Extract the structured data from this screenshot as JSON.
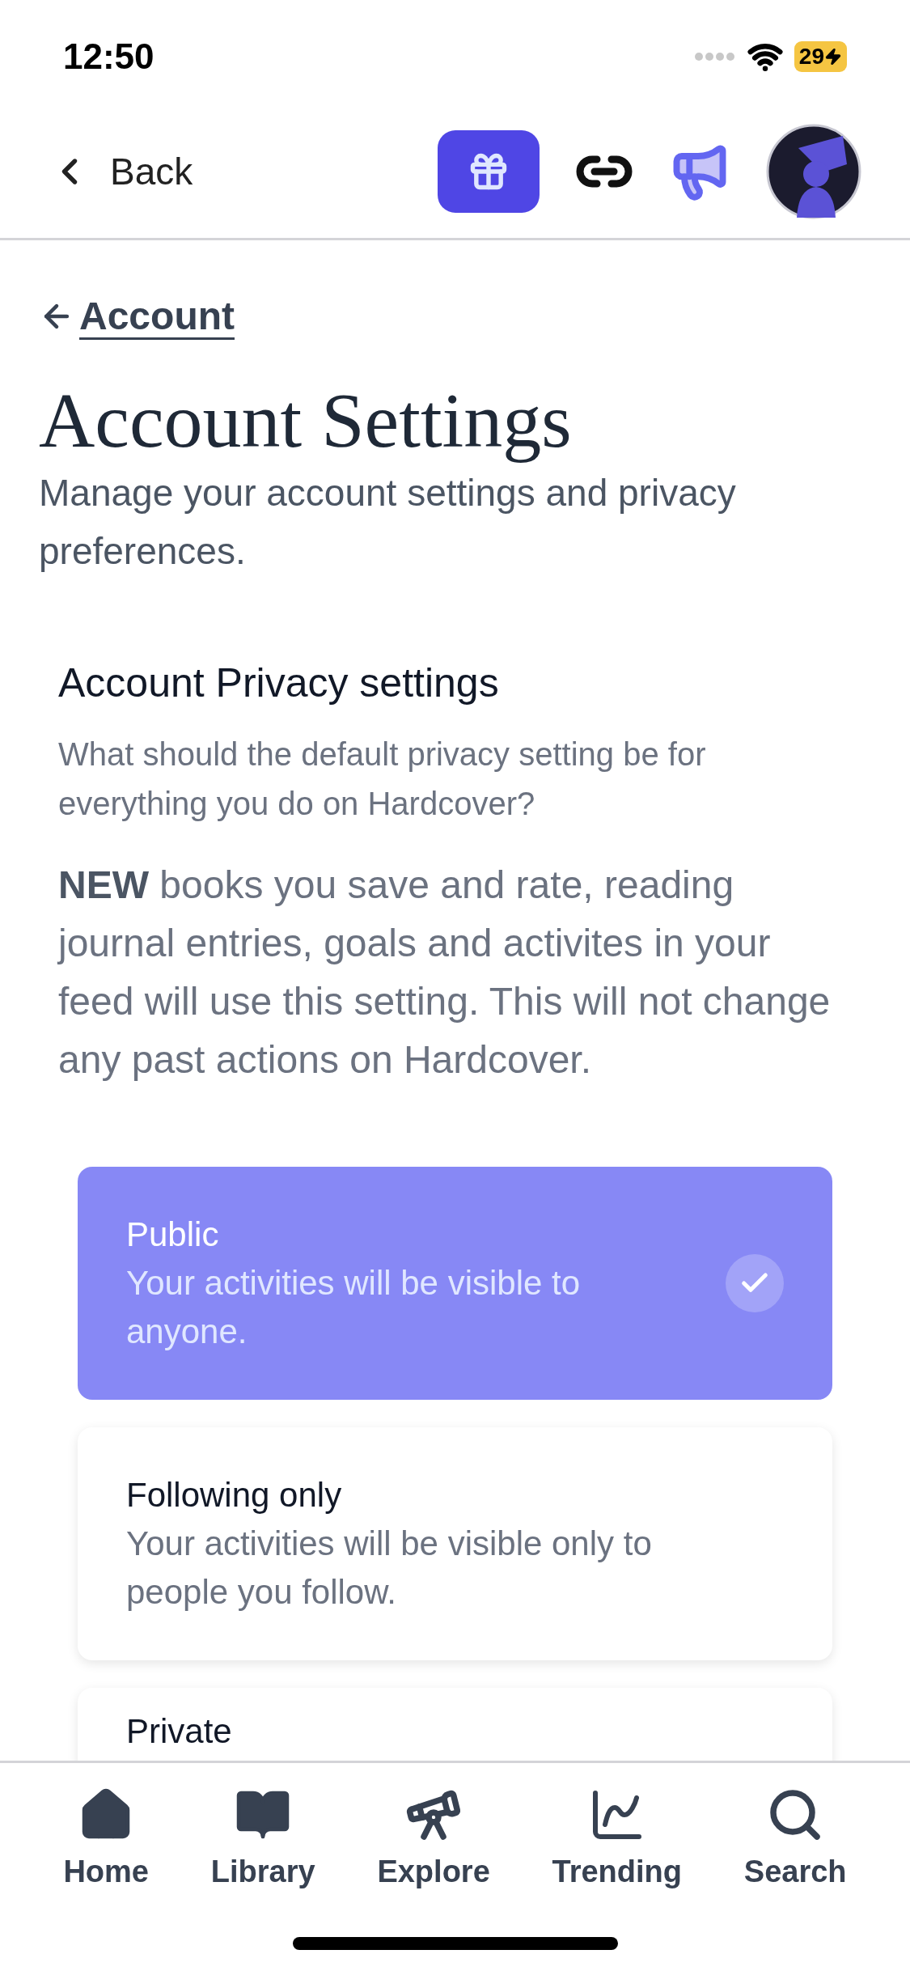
{
  "status_bar": {
    "time": "12:50",
    "battery": "29"
  },
  "header": {
    "back": "Back"
  },
  "breadcrumb": {
    "label": "Account"
  },
  "page": {
    "title": "Account Settings",
    "subtitle": "Manage your account settings and privacy preferences."
  },
  "section": {
    "title": "Account Privacy settings",
    "question": "What should the default privacy setting be for everything you do on Hardcover?",
    "note": "**NEW** books you save and rate, reading journal entries, goals and activites in your feed will use this setting. This will not change any past actions on Hardcover."
  },
  "options": [
    {
      "title": "Public",
      "description": "Your activities will be visible to anyone.",
      "selected": true
    },
    {
      "title": "Following only",
      "description": "Your activities will be visible only to people you follow.",
      "selected": false
    },
    {
      "title": "Private",
      "selected": false
    }
  ],
  "tab_bar": [
    {
      "kind": "home",
      "label": "Home"
    },
    {
      "kind": "library",
      "label": "Library"
    },
    {
      "kind": "explore",
      "label": "Explore"
    },
    {
      "kind": "trending",
      "label": "Trending"
    },
    {
      "kind": "search",
      "label": "Search"
    }
  ]
}
